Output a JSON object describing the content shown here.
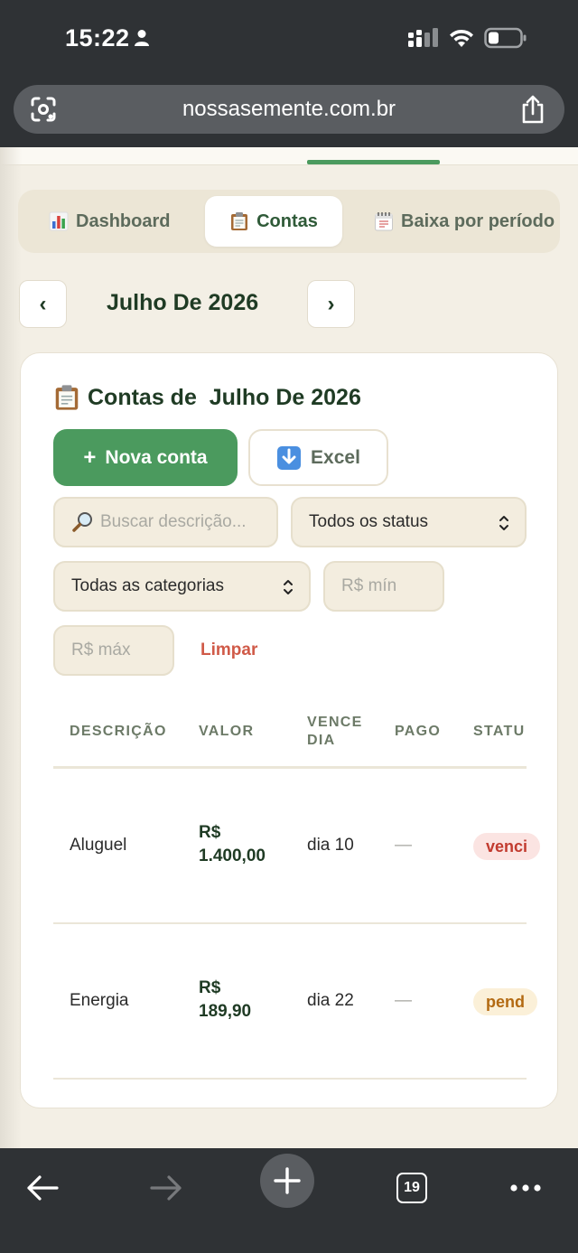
{
  "status_bar": {
    "time": "15:22"
  },
  "browser": {
    "url": "nossasemente.com.br",
    "tab_count": "19"
  },
  "tabs": [
    {
      "label": "Dashboard",
      "icon": "bar-chart-icon",
      "active": false
    },
    {
      "label": "Contas",
      "icon": "clipboard-icon",
      "active": true
    },
    {
      "label": "Baixa por período",
      "icon": "calendar-icon",
      "active": false
    }
  ],
  "month_nav": {
    "prev": "‹",
    "next": "›",
    "title": "Julho De 2026"
  },
  "card": {
    "title": "Contas de  Julho De 2026",
    "new_button": "Nova conta",
    "excel_button": "Excel",
    "search_placeholder": "Buscar descrição...",
    "status_filter": "Todos os status",
    "category_filter": "Todas as categorias",
    "min_placeholder": "R$ mín",
    "max_placeholder": "R$ máx",
    "clear_link": "Limpar"
  },
  "table": {
    "headers": [
      "DESCRIÇÃO",
      "VALOR",
      "VENCE\nDIA",
      "PAGO",
      "STATU"
    ],
    "rows": [
      {
        "descricao": "Aluguel",
        "valor_1": "R$",
        "valor_2": "1.400,00",
        "vence": "dia 10",
        "pago": "—",
        "status": "venci"
      },
      {
        "descricao": "Energia",
        "valor_1": "R$",
        "valor_2": "189,90",
        "vence": "dia 22",
        "pago": "—",
        "status": "pend"
      }
    ]
  },
  "colors": {
    "accent_green": "#4b9a5e",
    "danger": "#d05a48",
    "background": "#f3efe5"
  }
}
